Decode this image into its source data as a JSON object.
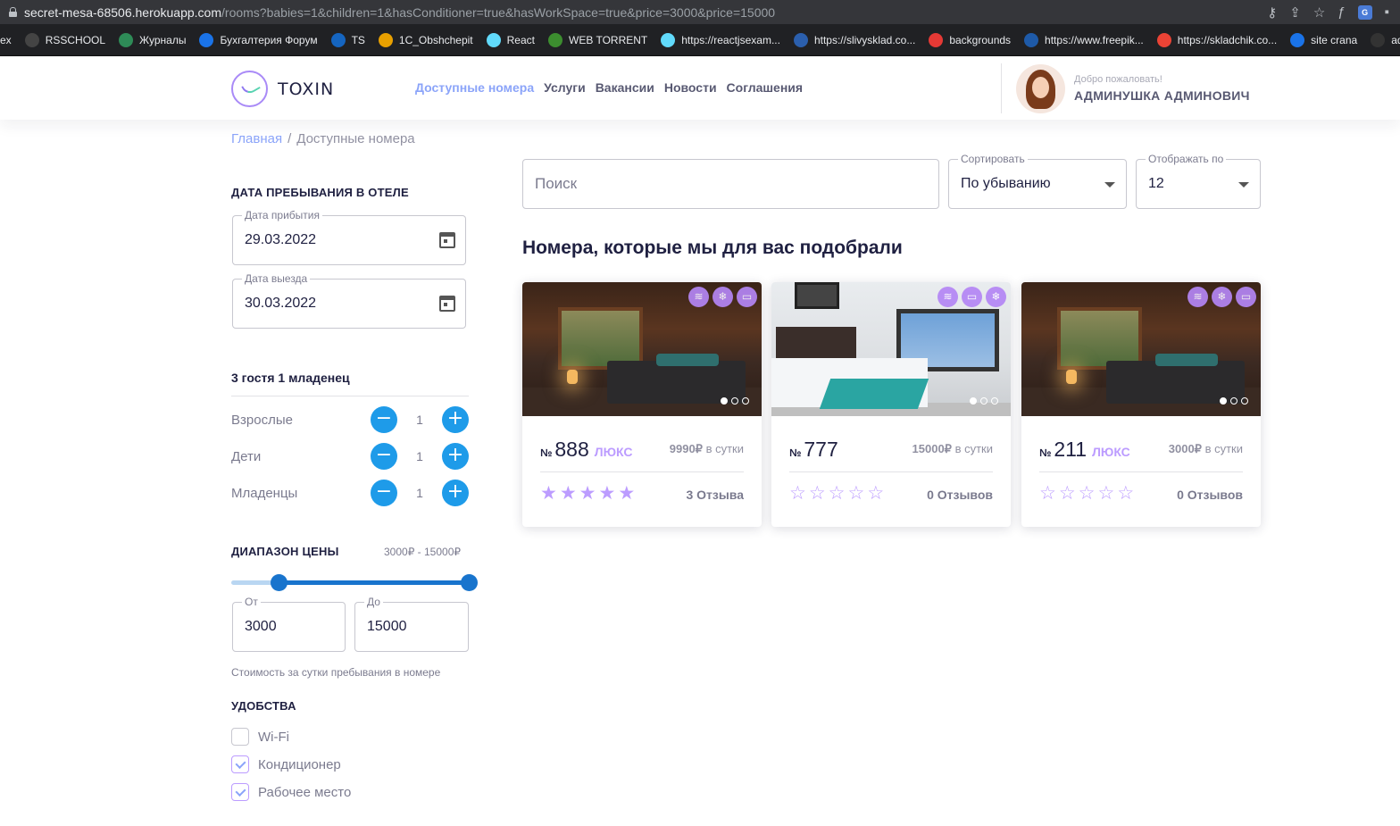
{
  "browser": {
    "url_host": "secret-mesa-68506.herokuapp.com",
    "url_rest": "/rooms?babies=1&children=1&hasConditioner=true&hasWorkSpace=true&price=3000&price=15000",
    "bookmarks": [
      "ex",
      "RSSCHOOL",
      "Журналы",
      "Бухгалтерия Форум",
      "TS",
      "1C_Obshchepit",
      "React",
      "WEB TORRENT",
      "https://reactjsexam...",
      "https://slivysklad.co...",
      "backgrounds",
      "https://www.freepik...",
      "https://skladchik.co...",
      "site crana",
      "ad"
    ]
  },
  "header": {
    "logo_text": "TOXIN",
    "nav": [
      "Доступные номера",
      "Услуги",
      "Вакансии",
      "Новости",
      "Соглашения"
    ],
    "welcome": "Добро пожаловать!",
    "user_name": "АДМИНУШКА АДМИНОВИЧ"
  },
  "breadcrumb": {
    "home": "Главная",
    "sep": "/",
    "current": "Доступные номера"
  },
  "filters": {
    "dates_title": "ДАТА ПРЕБЫВАНИЯ В ОТЕЛЕ",
    "arrival_label": "Дата прибытия",
    "arrival_value": "29.03.2022",
    "departure_label": "Дата выезда",
    "departure_value": "30.03.2022",
    "guests_summary": "3 гостя 1 младенец",
    "guests": [
      {
        "label": "Взрослые",
        "count": "1"
      },
      {
        "label": "Дети",
        "count": "1"
      },
      {
        "label": "Младенцы",
        "count": "1"
      }
    ],
    "price_title": "ДИАПАЗОН ЦЕНЫ",
    "price_range_text": "3000₽ - 15000₽",
    "price_min": 3000,
    "price_max": 15000,
    "price_slider_from_fraction": 0.2,
    "price_slider_to_fraction": 1.0,
    "from_label": "От",
    "from_value": "3000",
    "to_label": "До",
    "to_value": "15000",
    "price_note": "Стоимость за сутки пребывания в номере",
    "amenities_title": "УДОБСТВА",
    "amenities": [
      {
        "label": "Wi-Fi",
        "checked": false
      },
      {
        "label": "Кондиционер",
        "checked": true
      },
      {
        "label": "Рабочее место",
        "checked": true
      }
    ]
  },
  "toolbar": {
    "search_placeholder": "Поиск",
    "sort_label": "Сортировать",
    "sort_value": "По убыванию",
    "per_page_label": "Отображать по",
    "per_page_value": "12"
  },
  "rooms_title": "Номера, которые мы для вас подобрали",
  "rooms": [
    {
      "num_sign": "№",
      "number": "888",
      "type": "люкс",
      "price": "9990₽",
      "per": "в сутки",
      "rating": 5,
      "reviews": "3 Отзыва",
      "badges": [
        "wifi-icon",
        "snowflake-icon",
        "monitor-icon"
      ],
      "photo": "warm"
    },
    {
      "num_sign": "№",
      "number": "777",
      "type": "",
      "price": "15000₽",
      "per": "в сутки",
      "rating": 0,
      "reviews": "0 Отзывов",
      "badges": [
        "wifi-icon",
        "monitor-icon",
        "snowflake-icon"
      ],
      "photo": "cool"
    },
    {
      "num_sign": "№",
      "number": "211",
      "type": "люкс",
      "price": "3000₽",
      "per": "в сутки",
      "rating": 0,
      "reviews": "0 Отзывов",
      "badges": [
        "wifi-icon",
        "snowflake-icon",
        "monitor-icon"
      ],
      "photo": "warm"
    }
  ],
  "colors": {
    "accent": "#bc9cff",
    "nav_active": "#8ba4f9",
    "counter": "#1e9be9",
    "slider": "#1874cd"
  }
}
